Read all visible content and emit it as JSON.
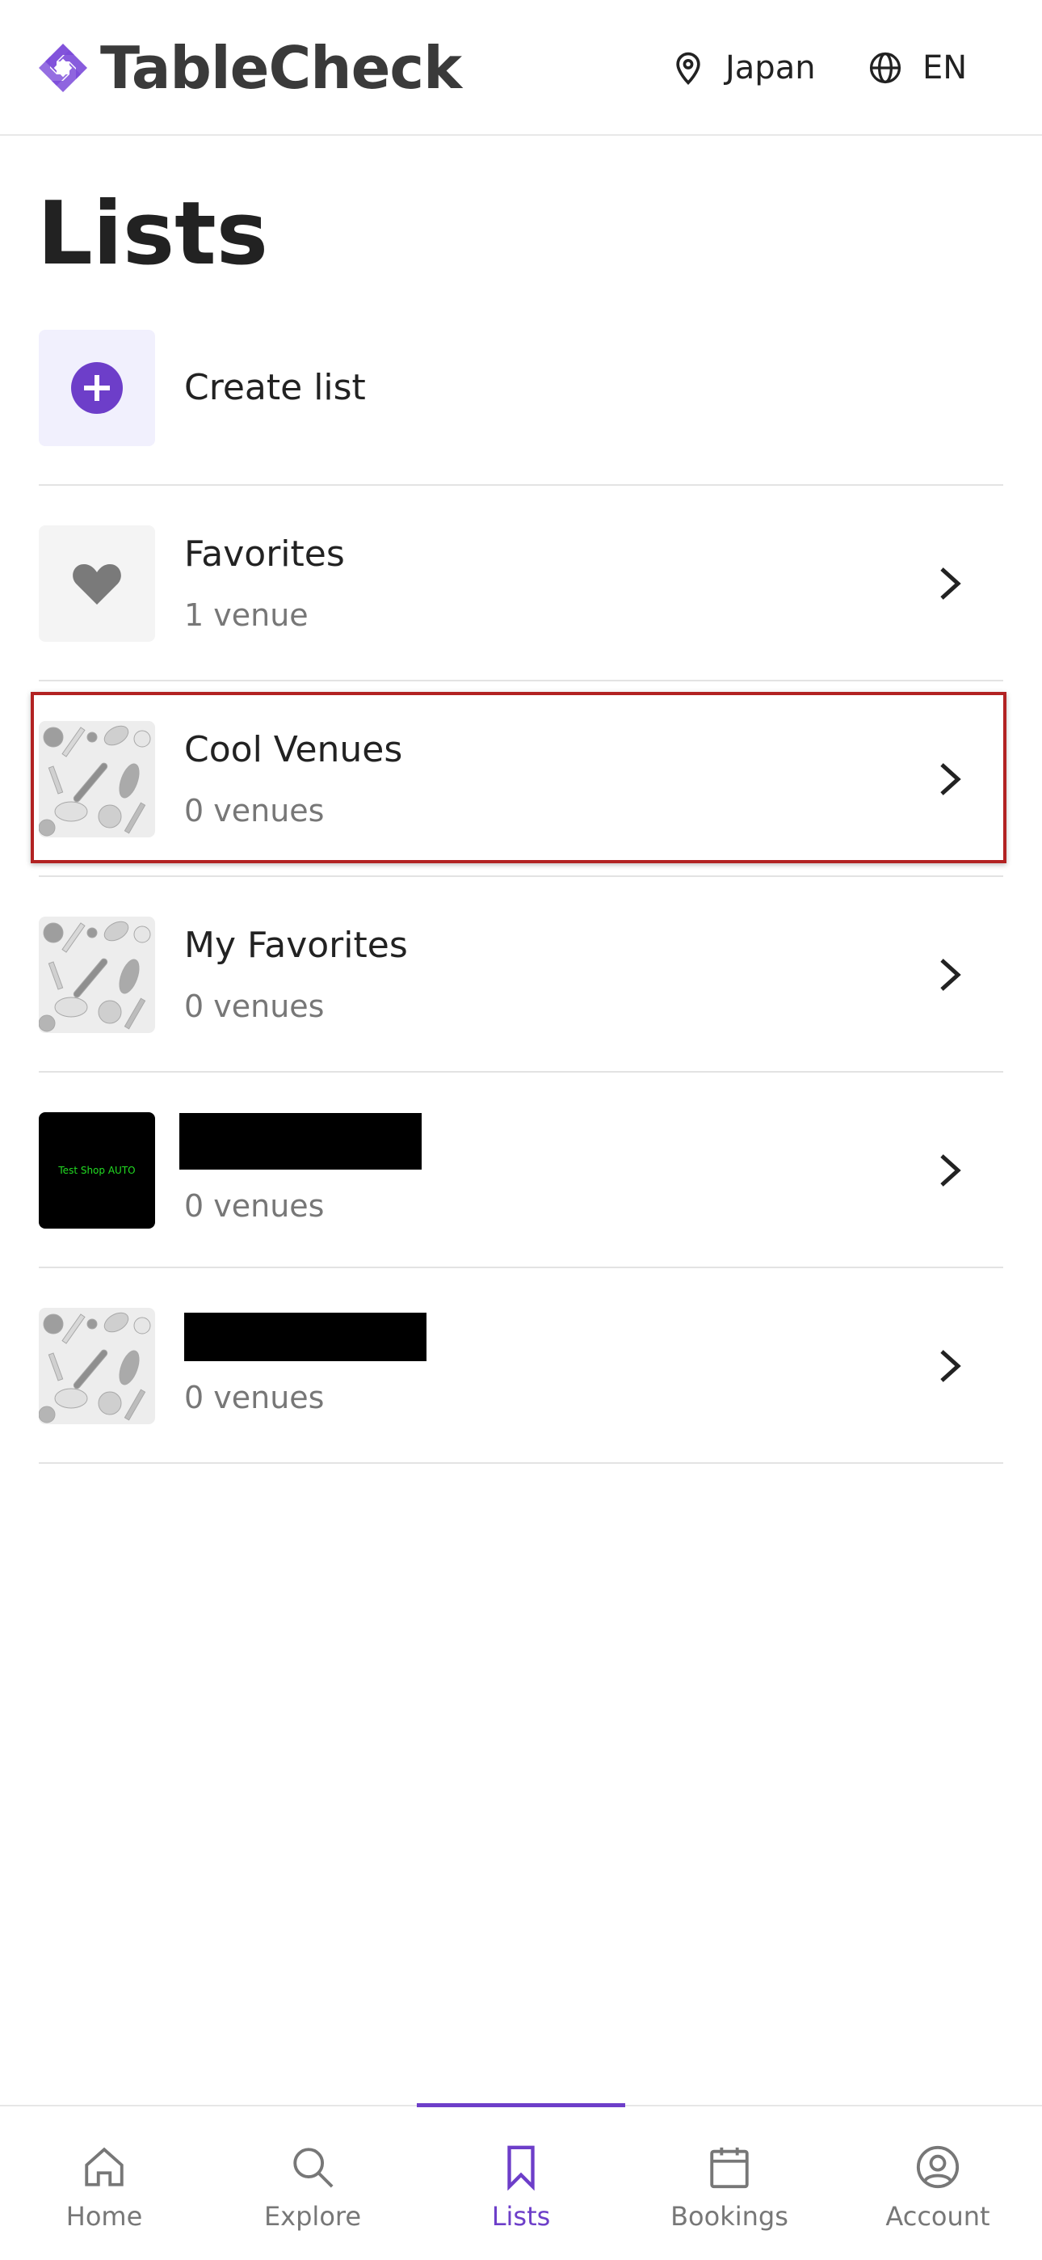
{
  "header": {
    "brand": "TableCheck",
    "region": "Japan",
    "language": "EN",
    "accent_color": "#7b4ad9"
  },
  "page": {
    "title": "Lists"
  },
  "create": {
    "label": "Create list",
    "icon": "plus-circle-icon"
  },
  "lists": [
    {
      "title": "Favorites",
      "subtitle": "1 venue",
      "thumb": "heart-icon"
    },
    {
      "title": "Cool Venues",
      "subtitle": "0 venues",
      "thumb": "tableware-pattern",
      "highlighted": true
    },
    {
      "title": "My Favorites",
      "subtitle": "0 venues",
      "thumb": "tableware-pattern"
    },
    {
      "title": "",
      "subtitle": "0 venues",
      "thumb": "shop-image",
      "thumb_text": "Test Shop AUTO",
      "title_redacted": true
    },
    {
      "title": "",
      "subtitle": "0 venues",
      "thumb": "tableware-pattern",
      "title_redacted": true
    }
  ],
  "nav": {
    "items": [
      {
        "label": "Home",
        "icon": "home-icon"
      },
      {
        "label": "Explore",
        "icon": "search-icon"
      },
      {
        "label": "Lists",
        "icon": "bookmark-icon",
        "active": true
      },
      {
        "label": "Bookings",
        "icon": "calendar-icon"
      },
      {
        "label": "Account",
        "icon": "user-circle-icon"
      }
    ],
    "active_color": "#6d3ec9"
  }
}
